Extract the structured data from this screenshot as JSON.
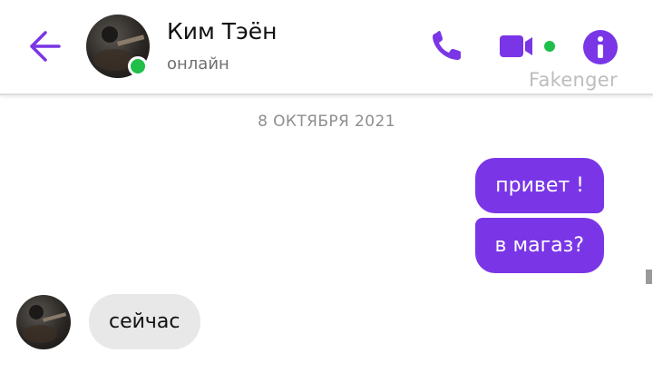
{
  "header": {
    "contact_name": "Ким Тэён",
    "status": "онлайн",
    "watermark": "Fakenger",
    "accent_color": "#7a36e6",
    "online_color": "#1fbf4a",
    "icons": [
      "back-arrow-icon",
      "phone-icon",
      "video-camera-icon",
      "info-icon"
    ]
  },
  "chat": {
    "date_separator": "8 ОКТЯБРЯ 2021",
    "messages": [
      {
        "direction": "outgoing",
        "text": "привет !"
      },
      {
        "direction": "outgoing",
        "text": "в магаз?"
      },
      {
        "direction": "incoming",
        "text": "сейчас"
      }
    ]
  }
}
